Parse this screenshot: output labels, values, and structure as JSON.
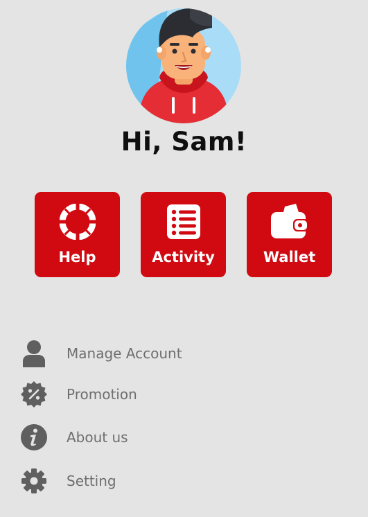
{
  "greeting": "Hi, Sam!",
  "avatar": {
    "icon": "user-avatar-illustration"
  },
  "actions": [
    {
      "label": "Help",
      "icon": "lifebuoy-icon"
    },
    {
      "label": "Activity",
      "icon": "list-icon"
    },
    {
      "label": "Wallet",
      "icon": "wallet-icon"
    }
  ],
  "menu": [
    {
      "label": "Manage Account",
      "icon": "person-icon"
    },
    {
      "label": "Promotion",
      "icon": "discount-badge-icon"
    },
    {
      "label": "About us",
      "icon": "info-icon"
    },
    {
      "label": "Setting",
      "icon": "gear-icon"
    }
  ],
  "colors": {
    "background": "#e4e4e4",
    "accent": "#d10a12",
    "text_dark": "#0f0f0f",
    "text_muted": "#6e6e6e",
    "icon_gray": "#5f5f5f"
  }
}
